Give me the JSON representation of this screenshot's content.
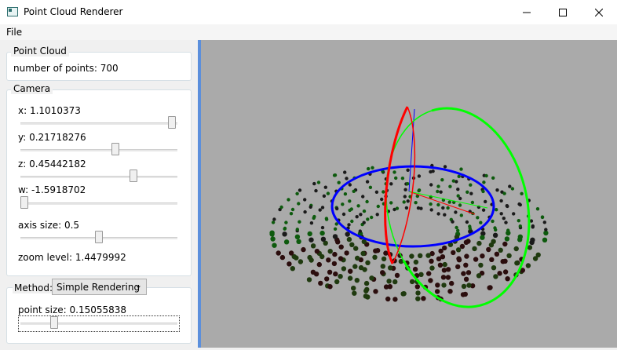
{
  "window": {
    "title": "Point Cloud Renderer"
  },
  "menu": {
    "file": "File"
  },
  "point_cloud": {
    "legend": "Point Cloud",
    "num_points": "number of points: 700"
  },
  "camera": {
    "legend": "Camera",
    "x": {
      "label": "x: 1.1010373",
      "value_fraction": 0.99
    },
    "y": {
      "label": "y: 0.21718276",
      "value_fraction": 0.61
    },
    "z": {
      "label": "z: 0.45442182",
      "value_fraction": 0.73
    },
    "w": {
      "label": "w: -1.5918702",
      "value_fraction": 0.0
    },
    "axis_size": {
      "label": "axis size: 0.5",
      "value_fraction": 0.5
    },
    "zoom": "zoom level: 1.4479992"
  },
  "method": {
    "label": "Method:",
    "selected": "Simple Rendering"
  },
  "point_size": {
    "label": "point size: 0.15055838",
    "value_fraction": 0.2
  },
  "colors": {
    "splitter": "#5b8fdc",
    "viewport_bg": "#aaaaaa",
    "x_axis": "#ff0000",
    "y_axis": "#00ff00",
    "z_axis": "#0000ff"
  }
}
